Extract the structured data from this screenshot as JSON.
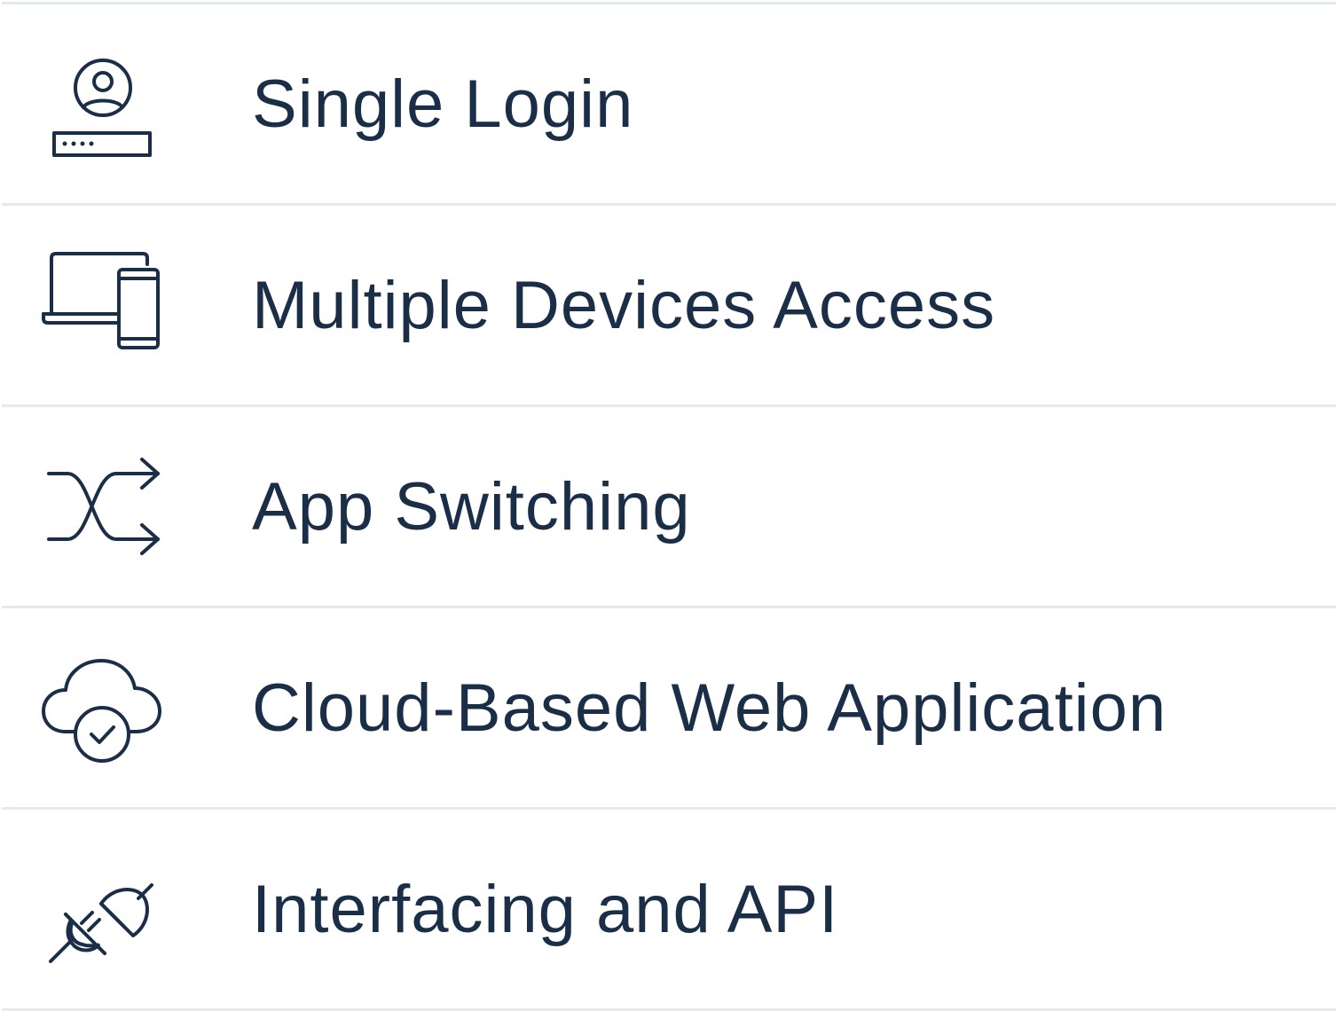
{
  "features": [
    {
      "label": "Single Login",
      "icon": "user-login-icon"
    },
    {
      "label": "Multiple Devices Access",
      "icon": "devices-icon"
    },
    {
      "label": "App Switching",
      "icon": "shuffle-icon"
    },
    {
      "label": "Cloud-Based Web Application",
      "icon": "cloud-check-icon"
    },
    {
      "label": "Interfacing and API",
      "icon": "plug-icon"
    }
  ],
  "colors": {
    "text": "#1b2e47",
    "divider": "#e3ebf0",
    "background": "#ffffff"
  }
}
